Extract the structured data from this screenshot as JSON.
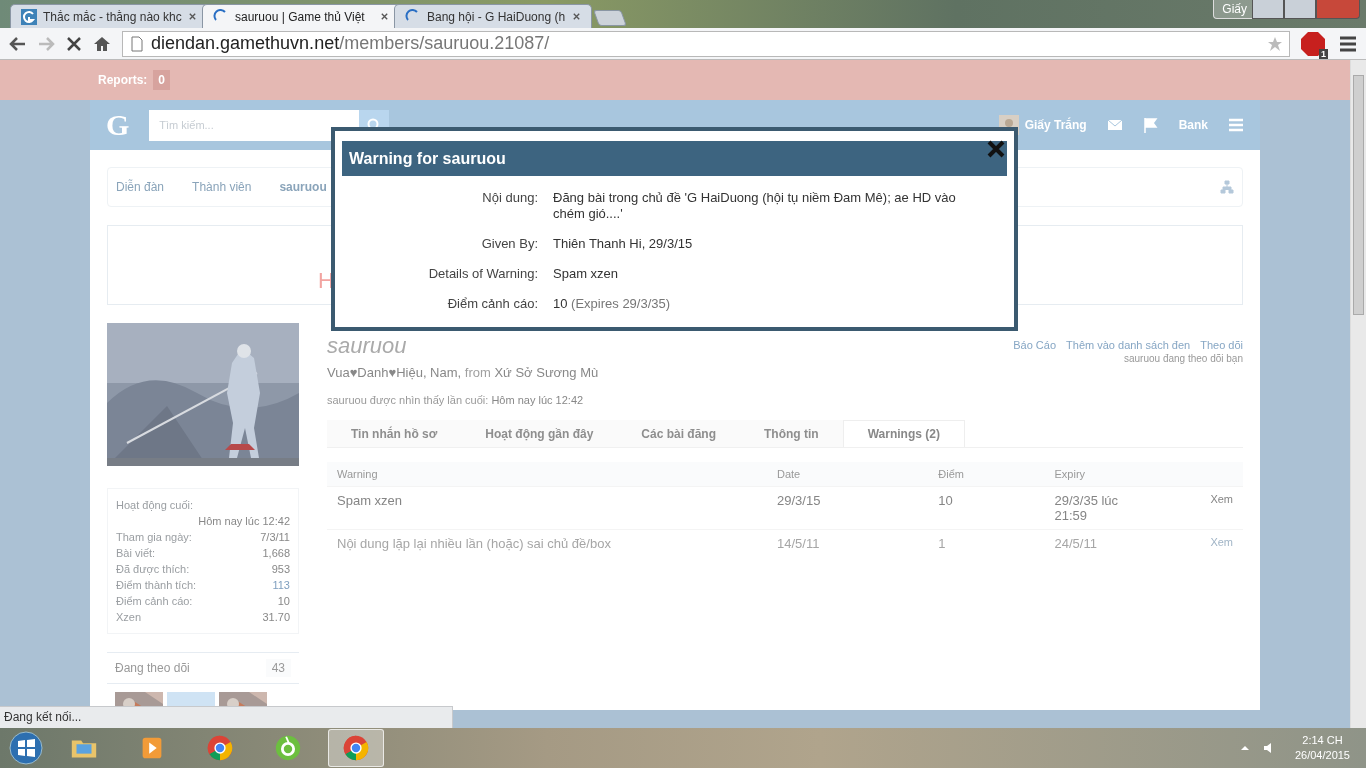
{
  "browser": {
    "tabs": [
      {
        "title": "Thắc mắc - thằng nào khc",
        "selected": false,
        "kind": "favicon"
      },
      {
        "title": "sauruou | Game thủ Việt",
        "selected": true,
        "kind": "loading"
      },
      {
        "title": "Bang hội - G HaiDuong (h",
        "selected": false,
        "kind": "loading"
      }
    ],
    "profile": "Giấy",
    "address": {
      "host": "diendan.gamethuvn.net",
      "path": "/members/sauruou.21087/"
    },
    "adblock_badge": "1",
    "status": "Đang kết nối..."
  },
  "page": {
    "reports": {
      "label": "Reports:",
      "count": "0"
    },
    "header": {
      "logo": "G",
      "search_placeholder": "Tìm kiếm...",
      "user": "Giấy Trắng",
      "bank": "Bank"
    },
    "breadcrumbs": [
      "Diễn đàn",
      "Thành viên",
      "sauruou"
    ],
    "notice": "H",
    "sidebar": {
      "stats": [
        {
          "label": "Hoạt động cuối:",
          "value": "Hôm nay lúc 12:42",
          "linked": false
        },
        {
          "label": "Tham gia ngày:",
          "value": "7/3/11",
          "linked": false
        },
        {
          "label": "Bài viết:",
          "value": "1,668",
          "linked": false
        },
        {
          "label": "Đã được thích:",
          "value": "953",
          "linked": false
        },
        {
          "label": "Điểm thành tích:",
          "value": "113",
          "linked": true
        },
        {
          "label": "Điểm cảnh cáo:",
          "value": "10",
          "linked": false
        },
        {
          "label": "Xzen",
          "value": "31.70",
          "linked": false
        }
      ],
      "following": {
        "label": "Đang theo dõi",
        "count": "43",
        "avatars": [
          {
            "kind": "picture"
          },
          {
            "kind": "placeholder"
          },
          {
            "kind": "picture"
          }
        ]
      }
    },
    "profile": {
      "username": "sauruou",
      "title": "Vua♥Danh♥Hiệu, Nam,",
      "from_label": "from",
      "location": "Xứ Sở Sương Mù",
      "last_seen_label": "sauruou được nhìn thấy lần cuối:",
      "last_seen": "Hôm nay lúc 12:42",
      "actions": [
        "Báo Cáo",
        "Thêm vào danh sách đen",
        "Theo dõi"
      ],
      "follows_you": "sauruou đang theo dõi bạn",
      "tabs": [
        {
          "label": "Tin nhắn hồ sơ",
          "selected": false
        },
        {
          "label": "Hoạt động gần đây",
          "selected": false
        },
        {
          "label": "Các bài đăng",
          "selected": false
        },
        {
          "label": "Thông tin",
          "selected": false
        },
        {
          "label": "Warnings (2)",
          "selected": true
        }
      ],
      "table": {
        "columns": [
          "Warning",
          "Date",
          "Điểm",
          "Expiry"
        ],
        "rows": [
          {
            "cells": [
              "Spam xzen",
              "29/3/15",
              "10",
              "29/3/35 lúc 21:59"
            ],
            "link": "Xem",
            "expired": false
          },
          {
            "cells": [
              "Nội dung lặp lại nhiều lần (hoặc) sai chủ đề/box",
              "14/5/11",
              "1",
              "24/5/11"
            ],
            "link": "Xem",
            "expired": true
          }
        ]
      }
    },
    "modal": {
      "title": "Warning for sauruou",
      "fields": [
        {
          "label": "Nội dung:",
          "value": "Đăng bài trong chủ đề 'G HaiDuong (hội tụ niềm Đam Mê); ae HD vào chém gió....'"
        },
        {
          "label": "Given By:",
          "value": "Thiên Thanh Hi, 29/3/15"
        },
        {
          "label": "Details of Warning:",
          "value": "Spam xzen"
        },
        {
          "label": "Điểm cảnh cáo:",
          "value": "10",
          "note": "(Expires 29/3/35)"
        }
      ]
    }
  },
  "taskbar": {
    "apps": [
      {
        "kind": "folder",
        "active": false
      },
      {
        "kind": "media",
        "active": false
      },
      {
        "kind": "chrome",
        "active": false
      },
      {
        "kind": "coccoc",
        "active": false
      },
      {
        "kind": "chrome",
        "active": true
      }
    ],
    "time": "2:14 CH",
    "date": "26/04/2015"
  }
}
